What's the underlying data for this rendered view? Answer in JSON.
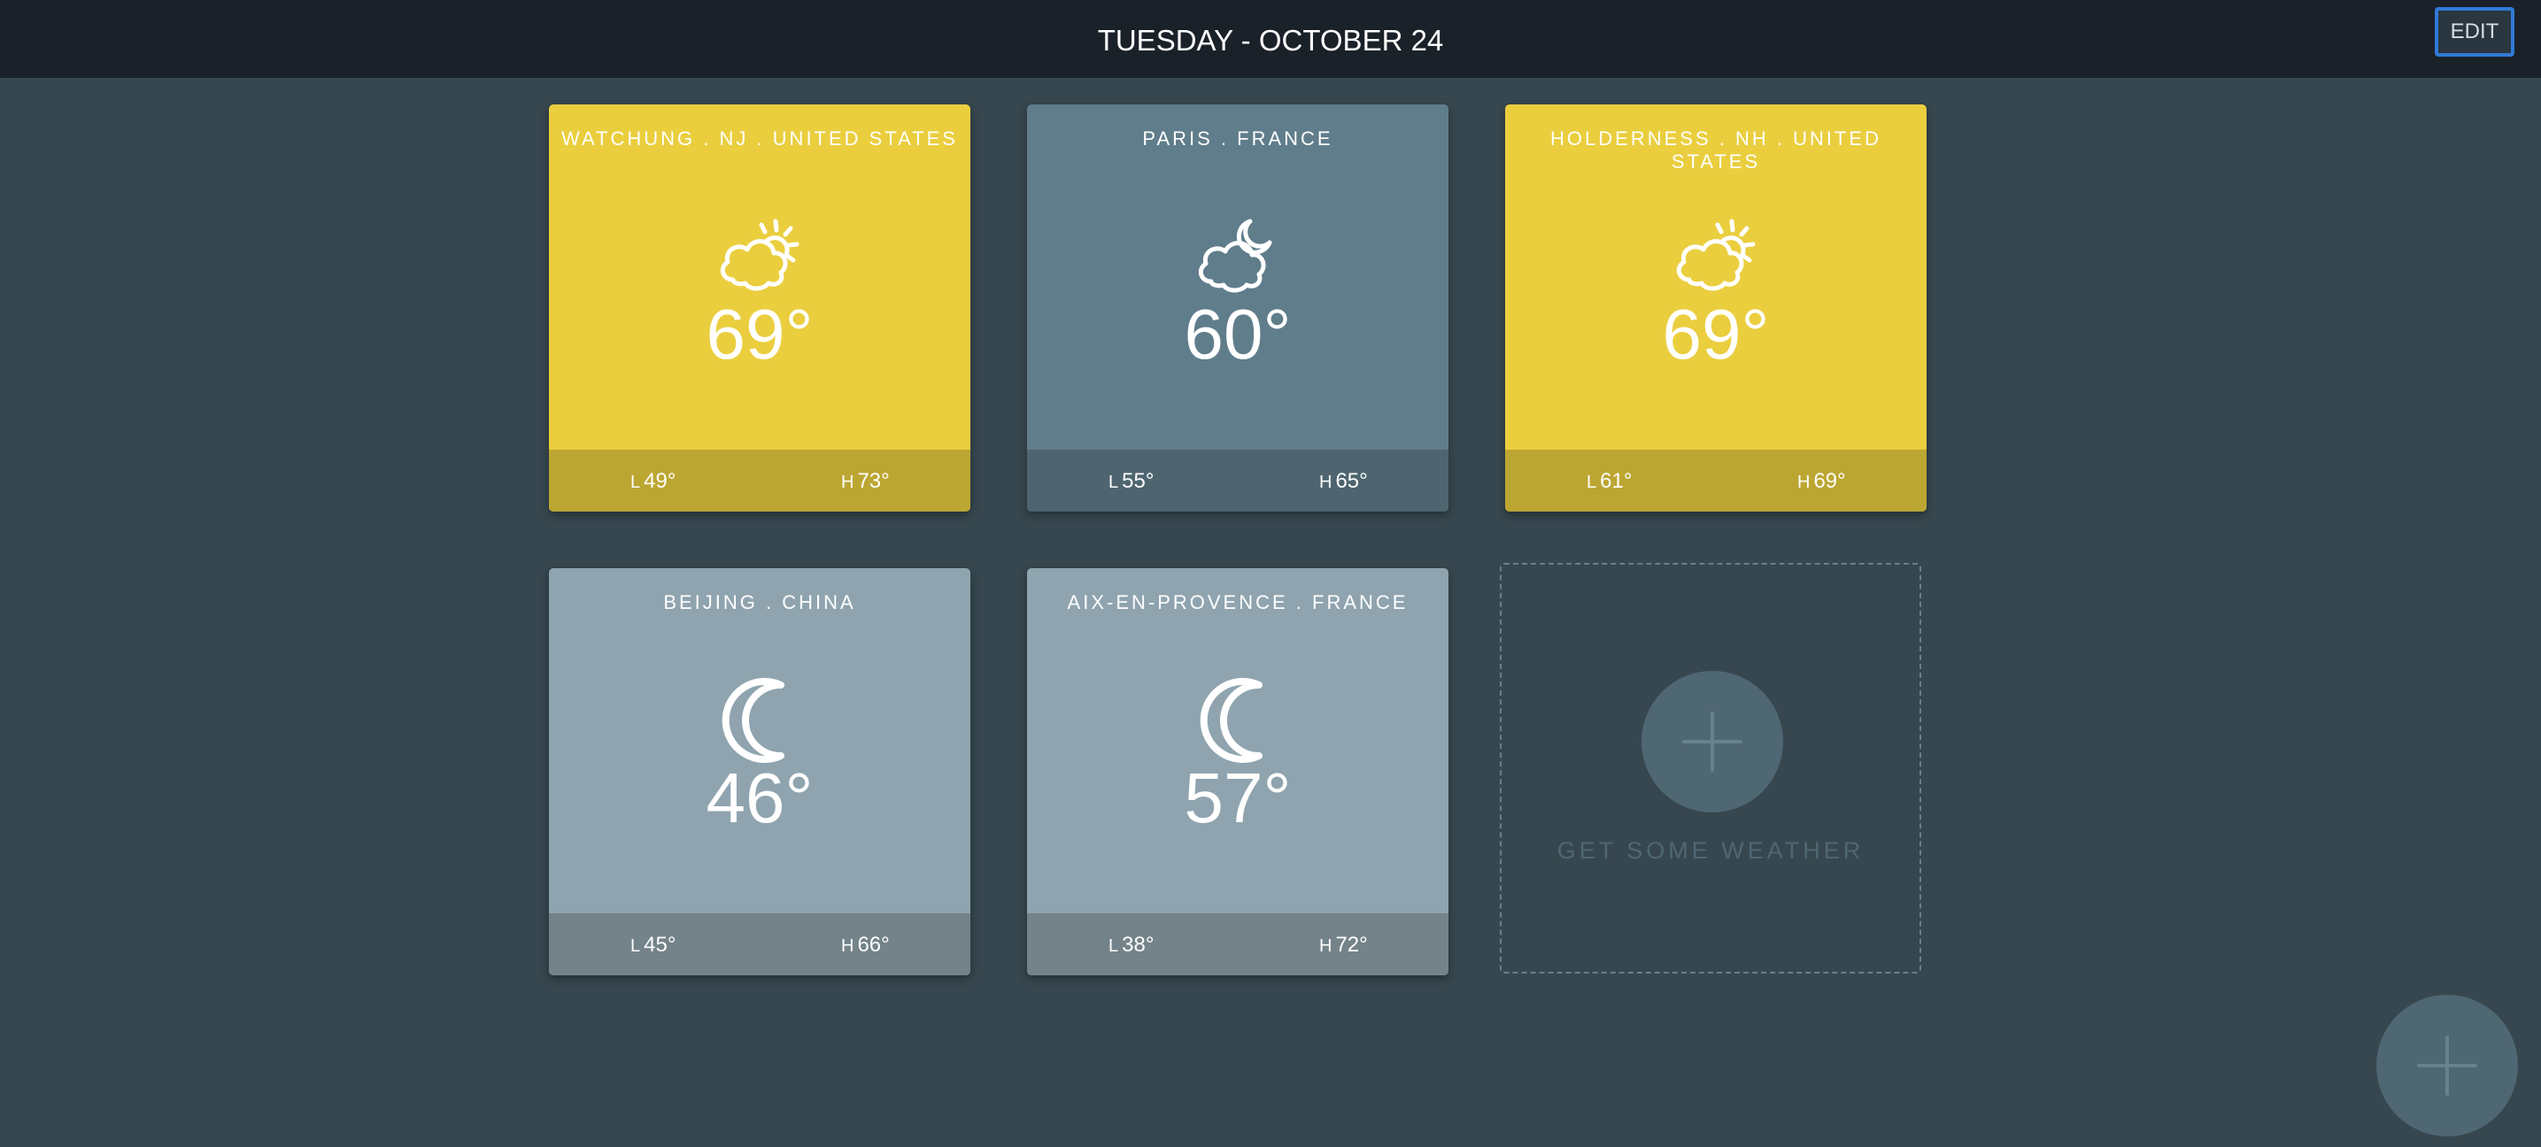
{
  "header": {
    "date": "TUESDAY - OCTOBER 24",
    "edit_label": "EDIT"
  },
  "cards": [
    {
      "location": "WATCHUNG . NJ . UNITED STATES",
      "condition": "partly-sunny",
      "icon": "sun-cloud-icon",
      "temp": "69°",
      "low_prefix": "L",
      "low": "49°",
      "high_prefix": "H",
      "high": "73°",
      "color": "#eace3e"
    },
    {
      "location": "PARIS . FRANCE",
      "condition": "partly-cloudy-night",
      "icon": "moon-cloud-icon",
      "temp": "60°",
      "low_prefix": "L",
      "low": "55°",
      "high_prefix": "H",
      "high": "65°",
      "color": "#607d8b"
    },
    {
      "location": "HOLDERNESS . NH . UNITED STATES",
      "condition": "partly-sunny",
      "icon": "sun-cloud-icon",
      "temp": "69°",
      "low_prefix": "L",
      "low": "61°",
      "high_prefix": "H",
      "high": "69°",
      "color": "#eace3e"
    },
    {
      "location": "BEIJING . CHINA",
      "condition": "clear-night",
      "icon": "moon-icon",
      "temp": "46°",
      "low_prefix": "L",
      "low": "45°",
      "high_prefix": "H",
      "high": "66°",
      "color": "#8fa4af"
    },
    {
      "location": "AIX-EN-PROVENCE . FRANCE",
      "condition": "clear-night",
      "icon": "moon-icon",
      "temp": "57°",
      "low_prefix": "L",
      "low": "38°",
      "high_prefix": "H",
      "high": "72°",
      "color": "#8fa4af"
    }
  ],
  "add_tile": {
    "label": "GET SOME WEATHER",
    "icon": "plus-icon"
  },
  "fab": {
    "icon": "plus-icon"
  }
}
